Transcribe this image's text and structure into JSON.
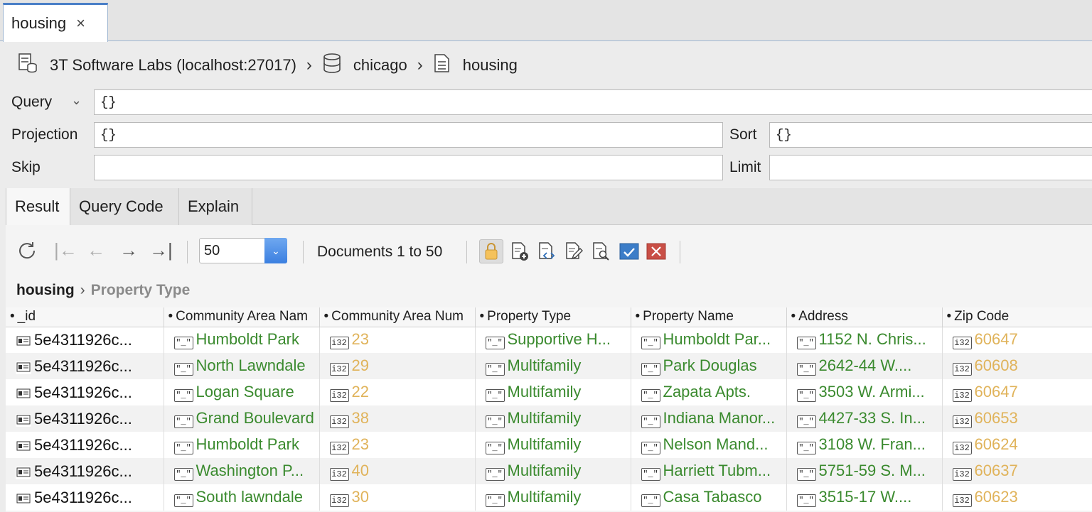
{
  "tab": {
    "label": "housing",
    "close": "×"
  },
  "breadcrumb": {
    "connection": "3T Software Labs (localhost:27017)",
    "database": "chicago",
    "collection": "housing"
  },
  "query_form": {
    "query_label": "Query",
    "query_value": "{}",
    "projection_label": "Projection",
    "projection_value": "{}",
    "sort_label": "Sort",
    "sort_value": "{}",
    "skip_label": "Skip",
    "skip_value": "",
    "limit_label": "Limit",
    "limit_value": ""
  },
  "subtabs": [
    "Result",
    "Query Code",
    "Explain"
  ],
  "toolbar": {
    "page_size": "50",
    "document_count": "Documents 1 to 50"
  },
  "path": {
    "root": "housing",
    "field": "Property Type"
  },
  "columns": [
    "_id",
    "Community Area Nam",
    "Community Area Num",
    "Property Type",
    "Property Name",
    "Address",
    "Zip Code"
  ],
  "rows": [
    [
      "5e4311926c...",
      "Humboldt Park",
      "23",
      "Supportive H...",
      "Humboldt Par...",
      "1152 N. Chris...",
      "60647"
    ],
    [
      "5e4311926c...",
      "North Lawndale",
      "29",
      "Multifamily",
      "Park Douglas",
      "2642-44 W....",
      "60608"
    ],
    [
      "5e4311926c...",
      "Logan Square",
      "22",
      "Multifamily",
      "Zapata Apts.",
      "3503 W. Armi...",
      "60647"
    ],
    [
      "5e4311926c...",
      "Grand Boulevard",
      "38",
      "Multifamily",
      "Indiana Manor...",
      "4427-33 S. In...",
      "60653"
    ],
    [
      "5e4311926c...",
      "Humboldt Park",
      "23",
      "Multifamily",
      "Nelson Mand...",
      "3108 W. Fran...",
      "60624"
    ],
    [
      "5e4311926c...",
      "Washington P...",
      "40",
      "Multifamily",
      "Harriett Tubm...",
      "5751-59 S. M...",
      "60637"
    ],
    [
      "5e4311926c...",
      "South lawndale",
      "30",
      "Multifamily",
      "Casa Tabasco",
      "3515-17 W....",
      "60623"
    ]
  ],
  "type_badges": {
    "id": "id-icon",
    "string": "\"_\"",
    "int": "i32"
  },
  "colors": {
    "accent": "#4a7fc7",
    "string_value": "#3a8a2e",
    "number_value": "#e0b35a"
  }
}
